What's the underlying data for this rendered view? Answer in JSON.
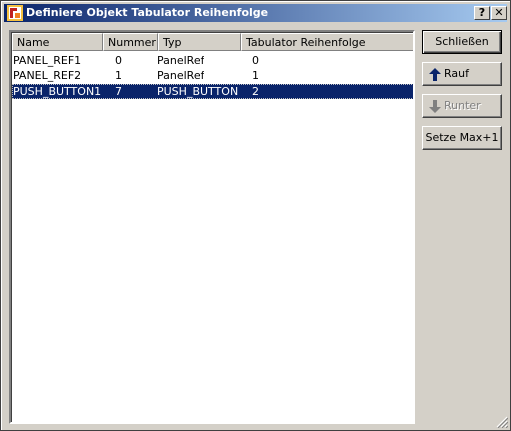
{
  "window": {
    "title": "Definiere Objekt Tabulator Reihenfolge",
    "help_label": "?",
    "close_label": "✕"
  },
  "table": {
    "columns": [
      "Name",
      "Nummer",
      "Typ",
      "Tabulator Reihenfolge"
    ],
    "rows": [
      {
        "name": "PANEL_REF1",
        "nummer": "0",
        "typ": "PanelRef",
        "tab": "0",
        "selected": false
      },
      {
        "name": "PANEL_REF2",
        "nummer": "1",
        "typ": "PanelRef",
        "tab": "1",
        "selected": false
      },
      {
        "name": "PUSH_BUTTON1",
        "nummer": "7",
        "typ": "PUSH_BUTTON",
        "tab": "2",
        "selected": true
      }
    ]
  },
  "buttons": {
    "close": "Schließen",
    "up": "Rauf",
    "down": "Runter",
    "setmax": "Setze Max+1"
  },
  "colors": {
    "selection": "#0a246a",
    "title_start": "#0a246a",
    "title_end": "#a6caf0",
    "face": "#d4d0c8",
    "arrow_up": "#0a246a",
    "arrow_disabled": "#808080"
  },
  "icons": {
    "app": "app-icon",
    "up": "arrow-up-icon",
    "down": "arrow-down-icon"
  }
}
